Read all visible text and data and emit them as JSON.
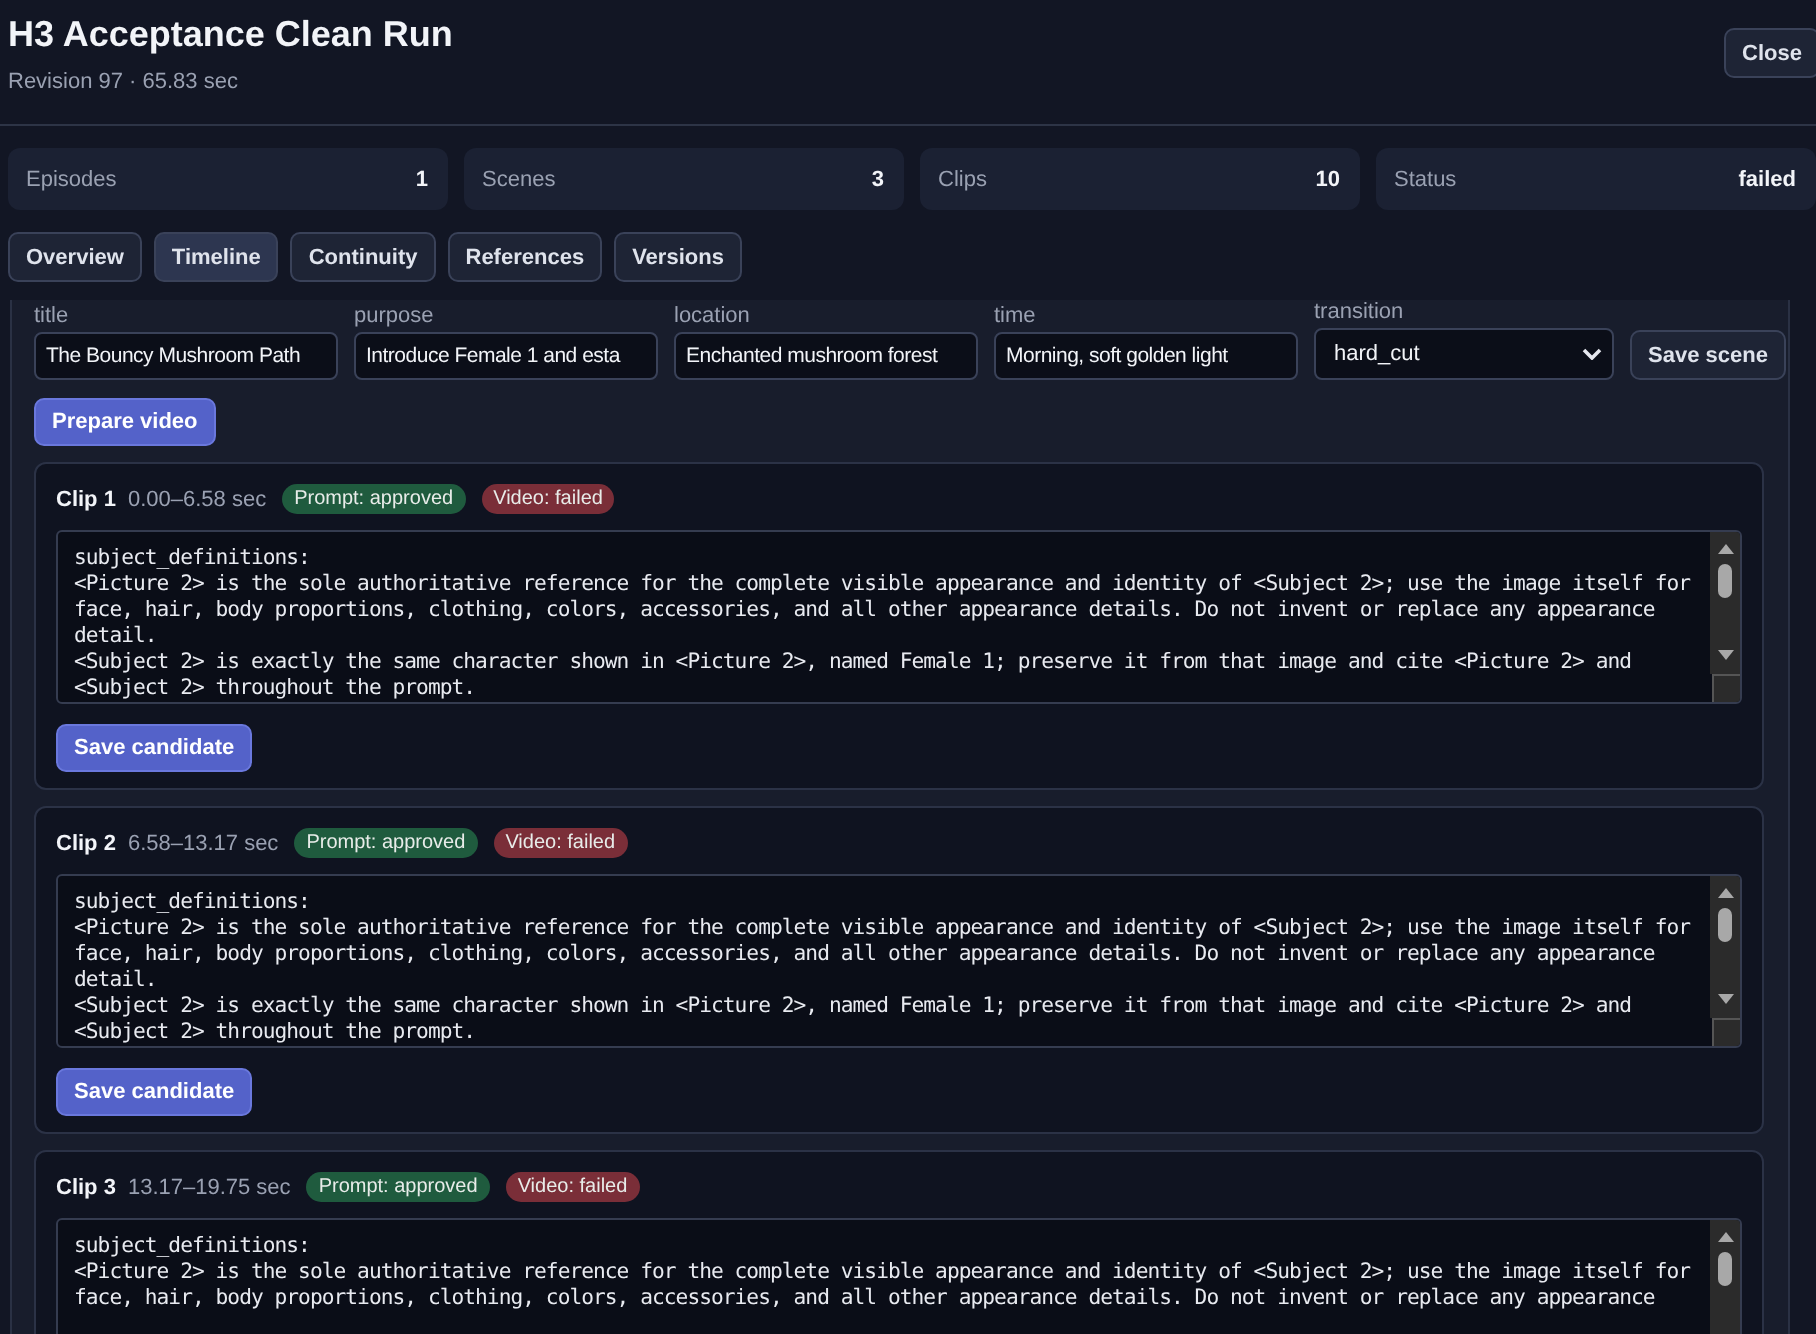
{
  "window": {
    "title": "H3 Acceptance Clean Run",
    "subtitle": "Revision 97 · 65.83 sec",
    "close_button": "Close"
  },
  "stats": [
    {
      "label": "Episodes",
      "value": "1"
    },
    {
      "label": "Scenes",
      "value": "3"
    },
    {
      "label": "Clips",
      "value": "10"
    },
    {
      "label": "Status",
      "value": "failed"
    }
  ],
  "tabs": [
    {
      "label": "Overview",
      "selected": false
    },
    {
      "label": "Timeline",
      "selected": true
    },
    {
      "label": "Continuity",
      "selected": false
    },
    {
      "label": "References",
      "selected": false
    },
    {
      "label": "Versions",
      "selected": false
    }
  ],
  "scene": {
    "fields": [
      {
        "kind": "text",
        "label": "title",
        "value": "The Bouncy Mushroom Path"
      },
      {
        "kind": "text",
        "label": "purpose",
        "value": "Introduce Female 1 and esta"
      },
      {
        "kind": "text",
        "label": "location",
        "value": "Enchanted mushroom forest"
      },
      {
        "kind": "text",
        "label": "time",
        "value": "Morning, soft golden light"
      },
      {
        "kind": "select",
        "label": "transition",
        "value": "hard_cut"
      }
    ],
    "save_button": "Save scene",
    "prepare_button": "Prepare video"
  },
  "clips": [
    {
      "title": "Clip 1",
      "time": "0.00–6.58 sec",
      "badges": [
        {
          "label": "Prompt: approved",
          "color": "#1f5b3e"
        },
        {
          "label": "Video: failed",
          "color": "#7a2e38"
        }
      ],
      "prompt_lines": [
        "subject_definitions:",
        "<Picture 2> is the sole authoritative reference for the complete visible appearance and identity of <Subject 2>; use the image itself for",
        "face, hair, body proportions, clothing, colors, accessories, and all other appearance details. Do not invent or replace any appearance",
        "detail.",
        "<Subject 2> is exactly the same character shown in <Picture 2>, named Female 1; preserve it from that image and cite <Picture 2> and",
        "<Subject 2> throughout the prompt."
      ],
      "save_button": "Save candidate"
    },
    {
      "title": "Clip 2",
      "time": "6.58–13.17 sec",
      "badges": [
        {
          "label": "Prompt: approved",
          "color": "#1f5b3e"
        },
        {
          "label": "Video: failed",
          "color": "#7a2e38"
        }
      ],
      "prompt_lines": [
        "subject_definitions:",
        "<Picture 2> is the sole authoritative reference for the complete visible appearance and identity of <Subject 2>; use the image itself for",
        "face, hair, body proportions, clothing, colors, accessories, and all other appearance details. Do not invent or replace any appearance",
        "detail.",
        "<Subject 2> is exactly the same character shown in <Picture 2>, named Female 1; preserve it from that image and cite <Picture 2> and",
        "<Subject 2> throughout the prompt."
      ],
      "save_button": "Save candidate"
    },
    {
      "title": "Clip 3",
      "time": "13.17–19.75 sec",
      "badges": [
        {
          "label": "Prompt: approved",
          "color": "#1f5b3e"
        },
        {
          "label": "Video: failed",
          "color": "#7a2e38"
        }
      ],
      "prompt_lines": [
        "subject_definitions:",
        "<Picture 2> is the sole authoritative reference for the complete visible appearance and identity of <Subject 2>; use the image itself for",
        "face, hair, body proportions, clothing, colors, accessories, and all other appearance details. Do not invent or replace any appearance"
      ]
    }
  ]
}
